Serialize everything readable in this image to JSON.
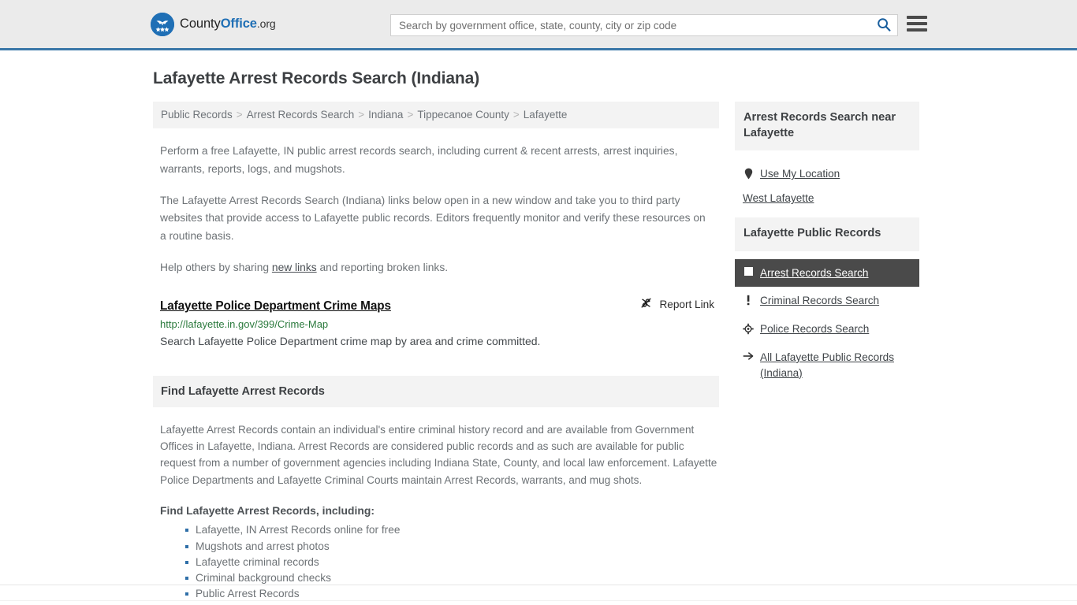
{
  "header": {
    "brand": {
      "part1": "County",
      "part2": "Office",
      "part3": ".org",
      "logo_icon": "eagle-stars-logo"
    },
    "search": {
      "placeholder": "Search by government office, state, county, city or zip code",
      "value": "",
      "button_icon": "search-icon"
    },
    "menu_icon": "hamburger-menu-icon",
    "accent_color": "#3a77a8"
  },
  "page": {
    "title": "Lafayette Arrest Records Search (Indiana)"
  },
  "breadcrumb": {
    "separator": ">",
    "items": [
      {
        "label": "Public Records"
      },
      {
        "label": "Arrest Records Search"
      },
      {
        "label": "Indiana"
      },
      {
        "label": "Tippecanoe County"
      },
      {
        "label": "Lafayette"
      }
    ]
  },
  "intro": {
    "paragraph1": "Perform a free Lafayette, IN public arrest records search, including current & recent arrests, arrest inquiries, warrants, reports, logs, and mugshots.",
    "paragraph2": "The Lafayette Arrest Records Search (Indiana) links below open in a new window and take you to third party websites that provide access to Lafayette public records. Editors frequently monitor and verify these resources on a routine basis.",
    "help_prefix": "Help others by sharing ",
    "help_link": "new links",
    "help_suffix": " and reporting broken links."
  },
  "result": {
    "title": "Lafayette Police Department Crime Maps",
    "url": "http://lafayette.in.gov/399/Crime-Map",
    "description": "Search Lafayette Police Department crime map by area and crime committed.",
    "report_label": "Report Link",
    "report_icon": "broken-link-icon",
    "url_color": "#2b7a3d"
  },
  "find_section": {
    "heading": "Find Lafayette Arrest Records",
    "body": "Lafayette Arrest Records contain an individual's entire criminal history record and are available from Government Offices in Lafayette, Indiana. Arrest Records are considered public records and as such are available for public request from a number of government agencies including Indiana State, County, and local law enforcement. Lafayette Police Departments and Lafayette Criminal Courts maintain Arrest Records, warrants, and mug shots.",
    "subheading": "Find Lafayette Arrest Records, including:",
    "bullets": [
      "Lafayette, IN Arrest Records online for free",
      "Mugshots and arrest photos",
      "Lafayette criminal records",
      "Criminal background checks",
      "Public Arrest Records"
    ]
  },
  "sidebar": {
    "near_panel": {
      "heading": "Arrest Records Search near Lafayette",
      "use_location": {
        "label": "Use My Location",
        "icon": "map-pin-icon"
      },
      "places": [
        {
          "label": "West Lafayette"
        }
      ]
    },
    "records_panel": {
      "heading": "Lafayette Public Records",
      "items": [
        {
          "label": "Arrest Records Search",
          "icon": "white-square-icon",
          "active": true
        },
        {
          "label": "Criminal Records Search",
          "icon": "exclamation-icon",
          "active": false
        },
        {
          "label": "Police Records Search",
          "icon": "crosshair-badge-icon",
          "active": false
        },
        {
          "label": "All Lafayette Public Records (Indiana)",
          "icon": "arrow-right-icon",
          "active": false
        }
      ],
      "active_bg_color": "#4a4a4a"
    }
  }
}
